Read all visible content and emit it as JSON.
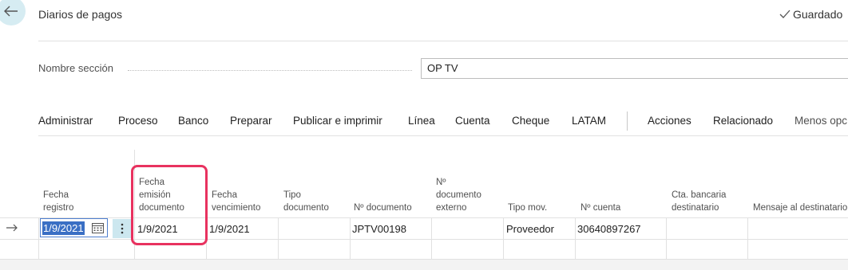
{
  "header": {
    "title": "Diarios de pagos",
    "status": "Guardado"
  },
  "section": {
    "label": "Nombre sección",
    "value": "OP TV"
  },
  "menu": [
    "Administrar",
    "Proceso",
    "Banco",
    "Preparar",
    "Publicar e imprimir",
    "Línea",
    "Cuenta",
    "Cheque",
    "LATAM",
    "Acciones",
    "Relacionado",
    "Menos opc"
  ],
  "columns": {
    "fecha_registro": "Fecha\nregistro",
    "fecha_emision": "Fecha\nemisión\ndocumento",
    "fecha_vencimiento": "Fecha\nvencimiento",
    "tipo_documento": "Tipo\ndocumento",
    "no_documento": "Nº documento",
    "no_documento_externo": "Nº\ndocumento\nexterno",
    "tipo_mov": "Tipo mov.",
    "no_cuenta": "Nº cuenta",
    "cta_bancaria": "Cta. bancaria\ndestinatario",
    "mensaje": "Mensaje al destinatario"
  },
  "row": {
    "fecha_registro": "1/9/2021",
    "fecha_emision": "1/9/2021",
    "fecha_vencimiento": "1/9/2021",
    "tipo_documento": "",
    "no_documento": "JPTV00198",
    "no_documento_externo": "",
    "tipo_mov": "Proveedor",
    "no_cuenta": "30640897267",
    "cta_bancaria": "",
    "mensaje": ""
  },
  "icons": {
    "back": "back-arrow-icon",
    "saved": "checkmark-icon",
    "calendar": "calendar-icon",
    "row_actions": "vertical-ellipsis-icon",
    "row_indicator": "arrow-right-icon"
  },
  "colors": {
    "accent": "#3a6fc4",
    "highlight": "#e8325f",
    "back_button_bg": "#d6ecf2"
  }
}
